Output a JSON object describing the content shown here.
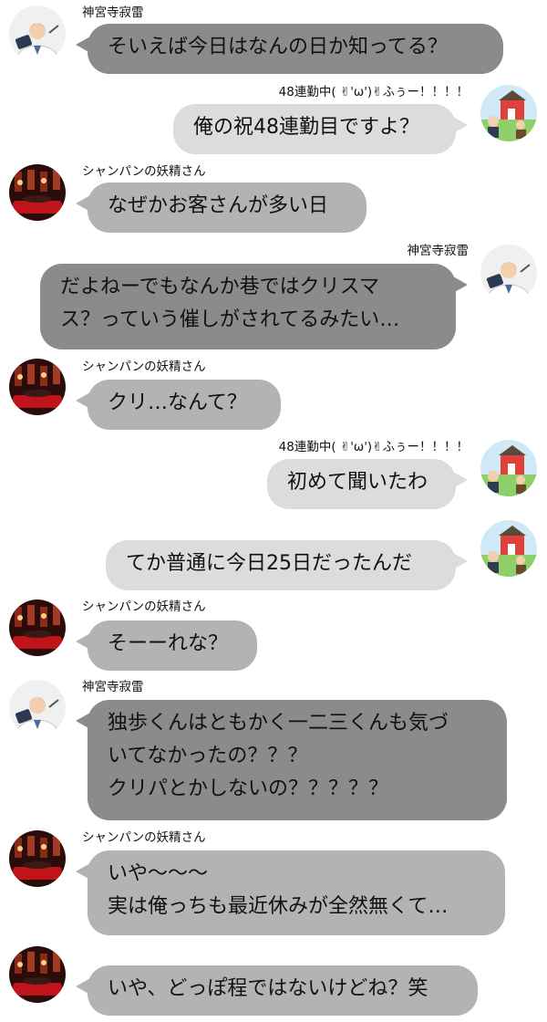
{
  "speakers": {
    "jinguji": "神宮寺寂雷",
    "shampagne": "シャンパンの妖精さん",
    "doppo": "48連勤中( ✌︎'ω')✌︎ふぅー！！！！"
  },
  "messages": [
    {
      "speaker": "jinguji",
      "text": "そいえば今日はなんの日か知ってる？"
    },
    {
      "speaker": "doppo",
      "text": "俺の祝48連勤目ですよ？"
    },
    {
      "speaker": "shampagne",
      "text": "なぜかお客さんが多い日"
    },
    {
      "speaker": "jinguji",
      "text": "だよねーでもなんか巷ではクリスマ\nス？っていう催しがされてるみたい…"
    },
    {
      "speaker": "shampagne",
      "text": "クリ…なんて？"
    },
    {
      "speaker": "doppo",
      "text": "初めて聞いたわ"
    },
    {
      "speaker": "doppo",
      "text": "てか普通に今日25日だったんだ"
    },
    {
      "speaker": "shampagne",
      "text": "そーーれな？"
    },
    {
      "speaker": "jinguji",
      "text": "独歩くんはともかく一二三くんも気づ\nいてなかったの？？？\nクリパとかしないの？？？？？"
    },
    {
      "speaker": "shampagne",
      "text": "いや〜〜〜\n実は俺っちも最近休みが全然無くて…"
    },
    {
      "speaker": "shampagne",
      "text": "いや、どっぽ程ではないけどね？笑"
    }
  ],
  "colors": {
    "bubble_dark": "#8b8b8b",
    "bubble_mid": "#b3b3b3",
    "bubble_light": "#dcdcdc",
    "background": "#ffffff"
  }
}
